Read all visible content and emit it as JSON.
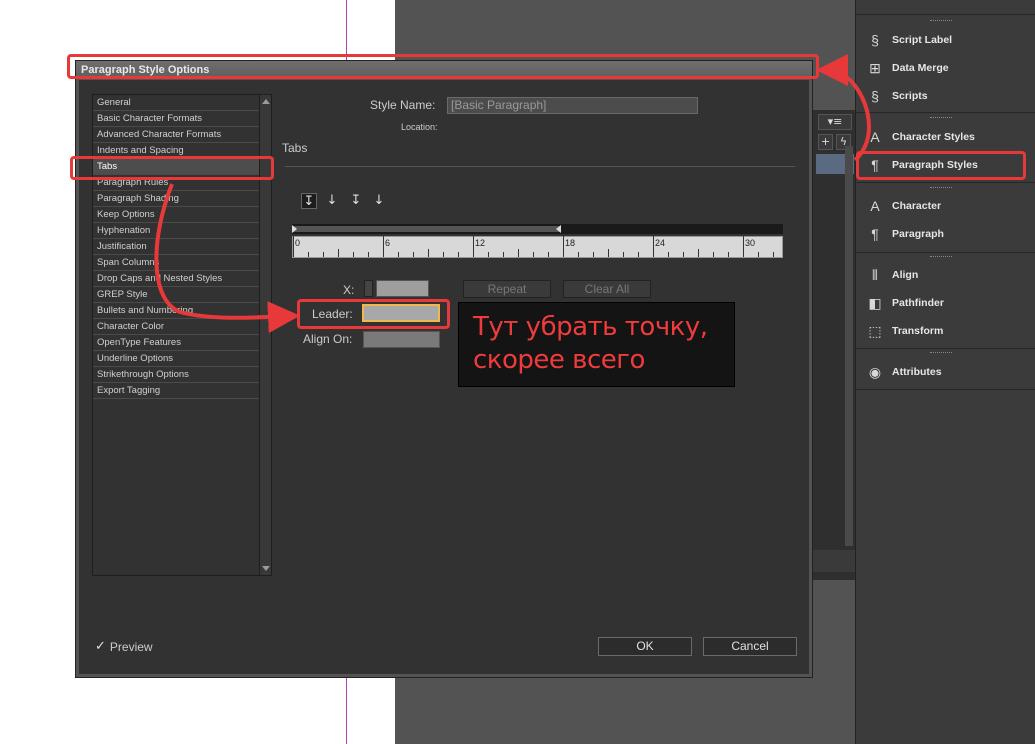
{
  "dialog": {
    "title": "Paragraph Style Options",
    "categories": [
      "General",
      "Basic Character Formats",
      "Advanced Character Formats",
      "Indents and Spacing",
      "Tabs",
      "Paragraph Rules",
      "Paragraph Shading",
      "Keep Options",
      "Hyphenation",
      "Justification",
      "Span Columns",
      "Drop Caps and Nested Styles",
      "GREP Style",
      "Bullets and Numbering",
      "Character Color",
      "OpenType Features",
      "Underline Options",
      "Strikethrough Options",
      "Export Tagging"
    ],
    "selected_category": "Tabs",
    "style_name_label": "Style Name:",
    "style_name_value": "[Basic Paragraph]",
    "location_label": "Location:",
    "section_title": "Tabs",
    "tab_types": [
      "left-justified-tab",
      "center-justified-tab",
      "right-justified-tab",
      "align-to-decimal-tab"
    ],
    "ruler_labels": [
      "0",
      "6",
      "12",
      "18",
      "24",
      "30"
    ],
    "x_label": "X:",
    "x_value": "",
    "leader_label": "Leader:",
    "leader_value": "",
    "align_on_label": "Align On:",
    "align_on_value": "",
    "repeat_button": "Repeat",
    "clear_all_button": "Clear All",
    "preview_label": "Preview",
    "preview_checked": true,
    "ok_button": "OK",
    "cancel_button": "Cancel"
  },
  "annotation": {
    "line1": "Тут убрать точку,",
    "line2": "скорее всего",
    "color": "#e8393a"
  },
  "panels": {
    "items": [
      {
        "label": "Script Label",
        "icon": "script-label-icon"
      },
      {
        "label": "Data Merge",
        "icon": "data-merge-icon"
      },
      {
        "label": "Scripts",
        "icon": "scripts-icon"
      },
      {
        "label": "Character Styles",
        "icon": "character-styles-icon"
      },
      {
        "label": "Paragraph Styles",
        "icon": "paragraph-styles-icon"
      },
      {
        "label": "Character",
        "icon": "character-icon"
      },
      {
        "label": "Paragraph",
        "icon": "paragraph-icon"
      },
      {
        "label": "Align",
        "icon": "align-icon"
      },
      {
        "label": "Pathfinder",
        "icon": "pathfinder-icon"
      },
      {
        "label": "Transform",
        "icon": "transform-icon"
      },
      {
        "label": "Attributes",
        "icon": "attributes-icon"
      }
    ]
  }
}
